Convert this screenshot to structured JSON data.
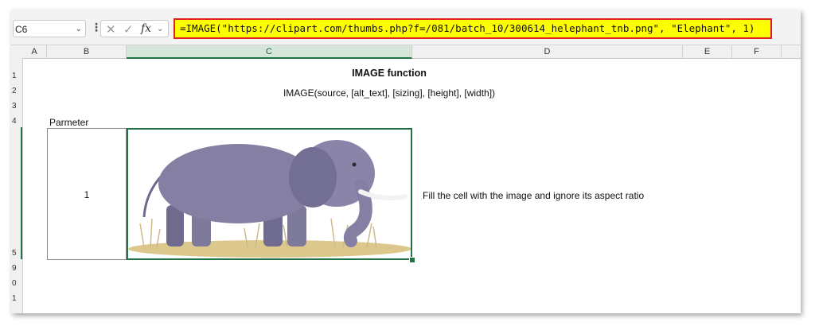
{
  "formula_bar": {
    "name_box": "C6",
    "fx_label": "fx",
    "formula": "=IMAGE(\"https://clipart.com/thumbs.php?f=/081/batch_10/300614_helephant_tnb.png\", \"Elephant\", 1)"
  },
  "columns": [
    "A",
    "B",
    "C",
    "D",
    "E",
    "F"
  ],
  "rows": [
    "1",
    "2",
    "3",
    "4",
    "5",
    "9",
    "0",
    "1"
  ],
  "sheet": {
    "title": "IMAGE function",
    "syntax": "IMAGE(source, [alt_text], [sizing], [height], [width])",
    "param_label": "Parmeter",
    "param_value": "1",
    "description": "Fill the cell with the image and ignore its aspect ratio"
  },
  "colors": {
    "accent": "#217346",
    "highlight": "#ffff00",
    "border_red": "#e02020"
  }
}
